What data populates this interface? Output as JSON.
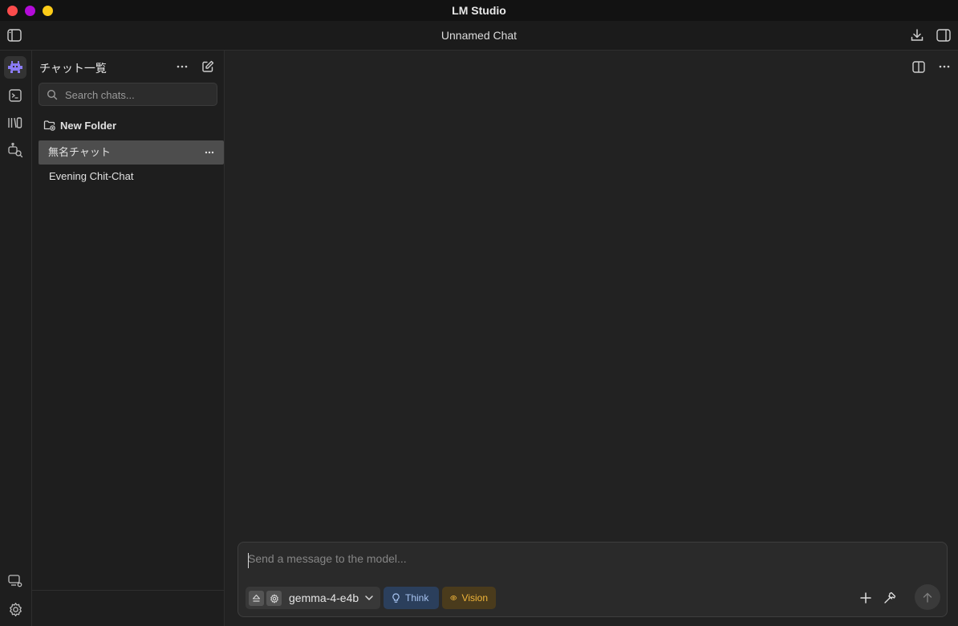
{
  "window": {
    "app_title": "LM Studio"
  },
  "header": {
    "chat_title": "Unnamed Chat"
  },
  "sidebar": {
    "title": "チャット一覧",
    "search_placeholder": "Search chats...",
    "new_folder_label": "New Folder",
    "chats": [
      {
        "label": "無名チャット",
        "selected": true
      },
      {
        "label": "Evening Chit-Chat",
        "selected": false
      }
    ]
  },
  "rail": {
    "items": [
      "chat-icon",
      "terminal-icon",
      "models-icon",
      "discover-icon"
    ],
    "bottom_items": [
      "runtime-icon",
      "settings-icon"
    ]
  },
  "composer": {
    "placeholder": "Send a message to the model...",
    "model_name": "gemma-4-e4b",
    "think_label": "Think",
    "vision_label": "Vision"
  },
  "colors": {
    "accent": "#8b7cf6",
    "think": "#a7c3f0",
    "vision": "#f0b53a"
  }
}
